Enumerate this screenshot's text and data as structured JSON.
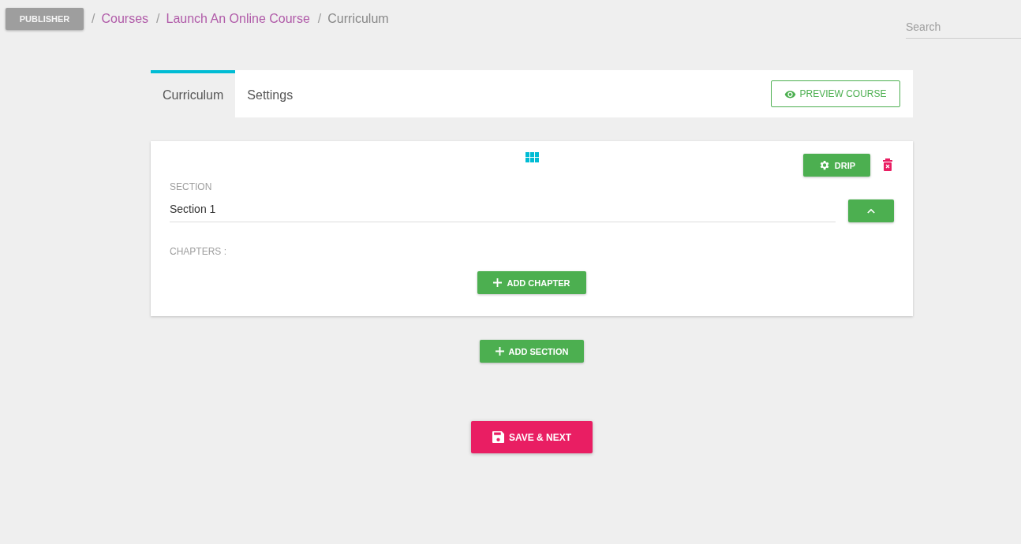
{
  "header": {
    "publisher_button": "PUBLISHER",
    "breadcrumb": [
      {
        "separator": "/",
        "label": "Courses",
        "kind": "link"
      },
      {
        "separator": "/",
        "label": "Launch An Online Course",
        "kind": "link"
      },
      {
        "separator": "/",
        "label": "Curriculum",
        "kind": "current"
      }
    ],
    "search": {
      "placeholder": "Search"
    }
  },
  "tabs": [
    {
      "label": "Curriculum",
      "selected": true
    },
    {
      "label": "Settings",
      "selected": false
    }
  ],
  "preview_button": "PREVIEW COURSE",
  "sections": [
    {
      "label": "SECTION",
      "value": "Section 1",
      "drip_button": "DRIP",
      "chapters_label": "CHAPTERS :",
      "add_chapter_button": "ADD CHAPTER",
      "expanded": true
    }
  ],
  "add_section_button": "ADD SECTION",
  "save_button": "SAVE & NEXT"
}
